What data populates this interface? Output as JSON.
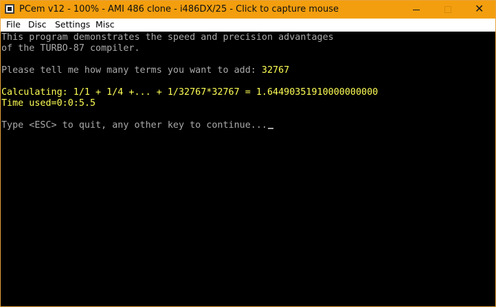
{
  "window": {
    "title": "PCem v12 - 100% - AMI 486 clone - i486DX/25 - Click to capture mouse",
    "titlebar_color": "#f39e0e",
    "close_symbol": "✕"
  },
  "menubar": {
    "items": [
      "File",
      "Disc",
      "Settings",
      "Misc"
    ]
  },
  "terminal": {
    "text_color": "#aaaaaa",
    "highlight_color": "#ffff55",
    "background": "#000000",
    "line1": "This program demonstrates the speed and precision advantages",
    "line2": "of the TURBO-87 compiler.",
    "prompt": "Please tell me how many terms you want to add: ",
    "prompt_answer": "32767",
    "calculating": "Calculating: 1/1 + 1/4 +... + 1/32767*32767 = 1.64490351910000000000",
    "time_used": "Time used=0:0:5.5",
    "continue_prompt": "Type <ESC> to quit, any other key to continue..."
  }
}
